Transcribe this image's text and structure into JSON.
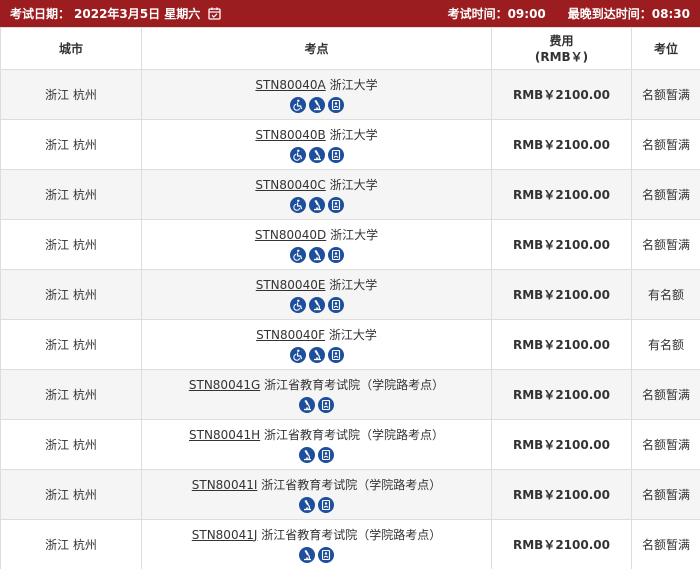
{
  "header": {
    "exam_date_label": "考试日期：",
    "exam_date": "2022年3月5日 星期六",
    "exam_time_label": "考试时间：",
    "exam_time": "09:00",
    "latest_arrival_label": "最晚到达时间：",
    "latest_arrival": "08:30",
    "calendar_icon": "calendar-check-icon"
  },
  "columns": {
    "city": "城市",
    "center": "考点",
    "fee": "费用\n(RMB￥)",
    "seat": "考位"
  },
  "colors": {
    "header_bg": "#9b1d20",
    "icon_bg": "#1e4f9c",
    "row_alt": "#f5f5f5"
  },
  "rows": [
    {
      "city": "浙江 杭州",
      "code": "STN80040A",
      "name": "浙江大学",
      "icons": [
        "wheelchair-icon",
        "microscope-icon",
        "id-card-icon"
      ],
      "fee": "RMB￥2100.00",
      "status": "名额暂满"
    },
    {
      "city": "浙江 杭州",
      "code": "STN80040B",
      "name": "浙江大学",
      "icons": [
        "wheelchair-icon",
        "microscope-icon",
        "id-card-icon"
      ],
      "fee": "RMB￥2100.00",
      "status": "名额暂满"
    },
    {
      "city": "浙江 杭州",
      "code": "STN80040C",
      "name": "浙江大学",
      "icons": [
        "wheelchair-icon",
        "microscope-icon",
        "id-card-icon"
      ],
      "fee": "RMB￥2100.00",
      "status": "名额暂满"
    },
    {
      "city": "浙江 杭州",
      "code": "STN80040D",
      "name": "浙江大学",
      "icons": [
        "wheelchair-icon",
        "microscope-icon",
        "id-card-icon"
      ],
      "fee": "RMB￥2100.00",
      "status": "名额暂满"
    },
    {
      "city": "浙江 杭州",
      "code": "STN80040E",
      "name": "浙江大学",
      "icons": [
        "wheelchair-icon",
        "microscope-icon",
        "id-card-icon"
      ],
      "fee": "RMB￥2100.00",
      "status": "有名额"
    },
    {
      "city": "浙江 杭州",
      "code": "STN80040F",
      "name": "浙江大学",
      "icons": [
        "wheelchair-icon",
        "microscope-icon",
        "id-card-icon"
      ],
      "fee": "RMB￥2100.00",
      "status": "有名额"
    },
    {
      "city": "浙江 杭州",
      "code": "STN80041G",
      "name": "浙江省教育考试院（学院路考点）",
      "icons": [
        "microscope-icon",
        "id-card-icon"
      ],
      "fee": "RMB￥2100.00",
      "status": "名额暂满"
    },
    {
      "city": "浙江 杭州",
      "code": "STN80041H",
      "name": "浙江省教育考试院（学院路考点）",
      "icons": [
        "microscope-icon",
        "id-card-icon"
      ],
      "fee": "RMB￥2100.00",
      "status": "名额暂满"
    },
    {
      "city": "浙江 杭州",
      "code": "STN80041I",
      "name": "浙江省教育考试院（学院路考点）",
      "icons": [
        "microscope-icon",
        "id-card-icon"
      ],
      "fee": "RMB￥2100.00",
      "status": "名额暂满"
    },
    {
      "city": "浙江 杭州",
      "code": "STN80041J",
      "name": "浙江省教育考试院（学院路考点）",
      "icons": [
        "microscope-icon",
        "id-card-icon"
      ],
      "fee": "RMB￥2100.00",
      "status": "名额暂满"
    }
  ]
}
